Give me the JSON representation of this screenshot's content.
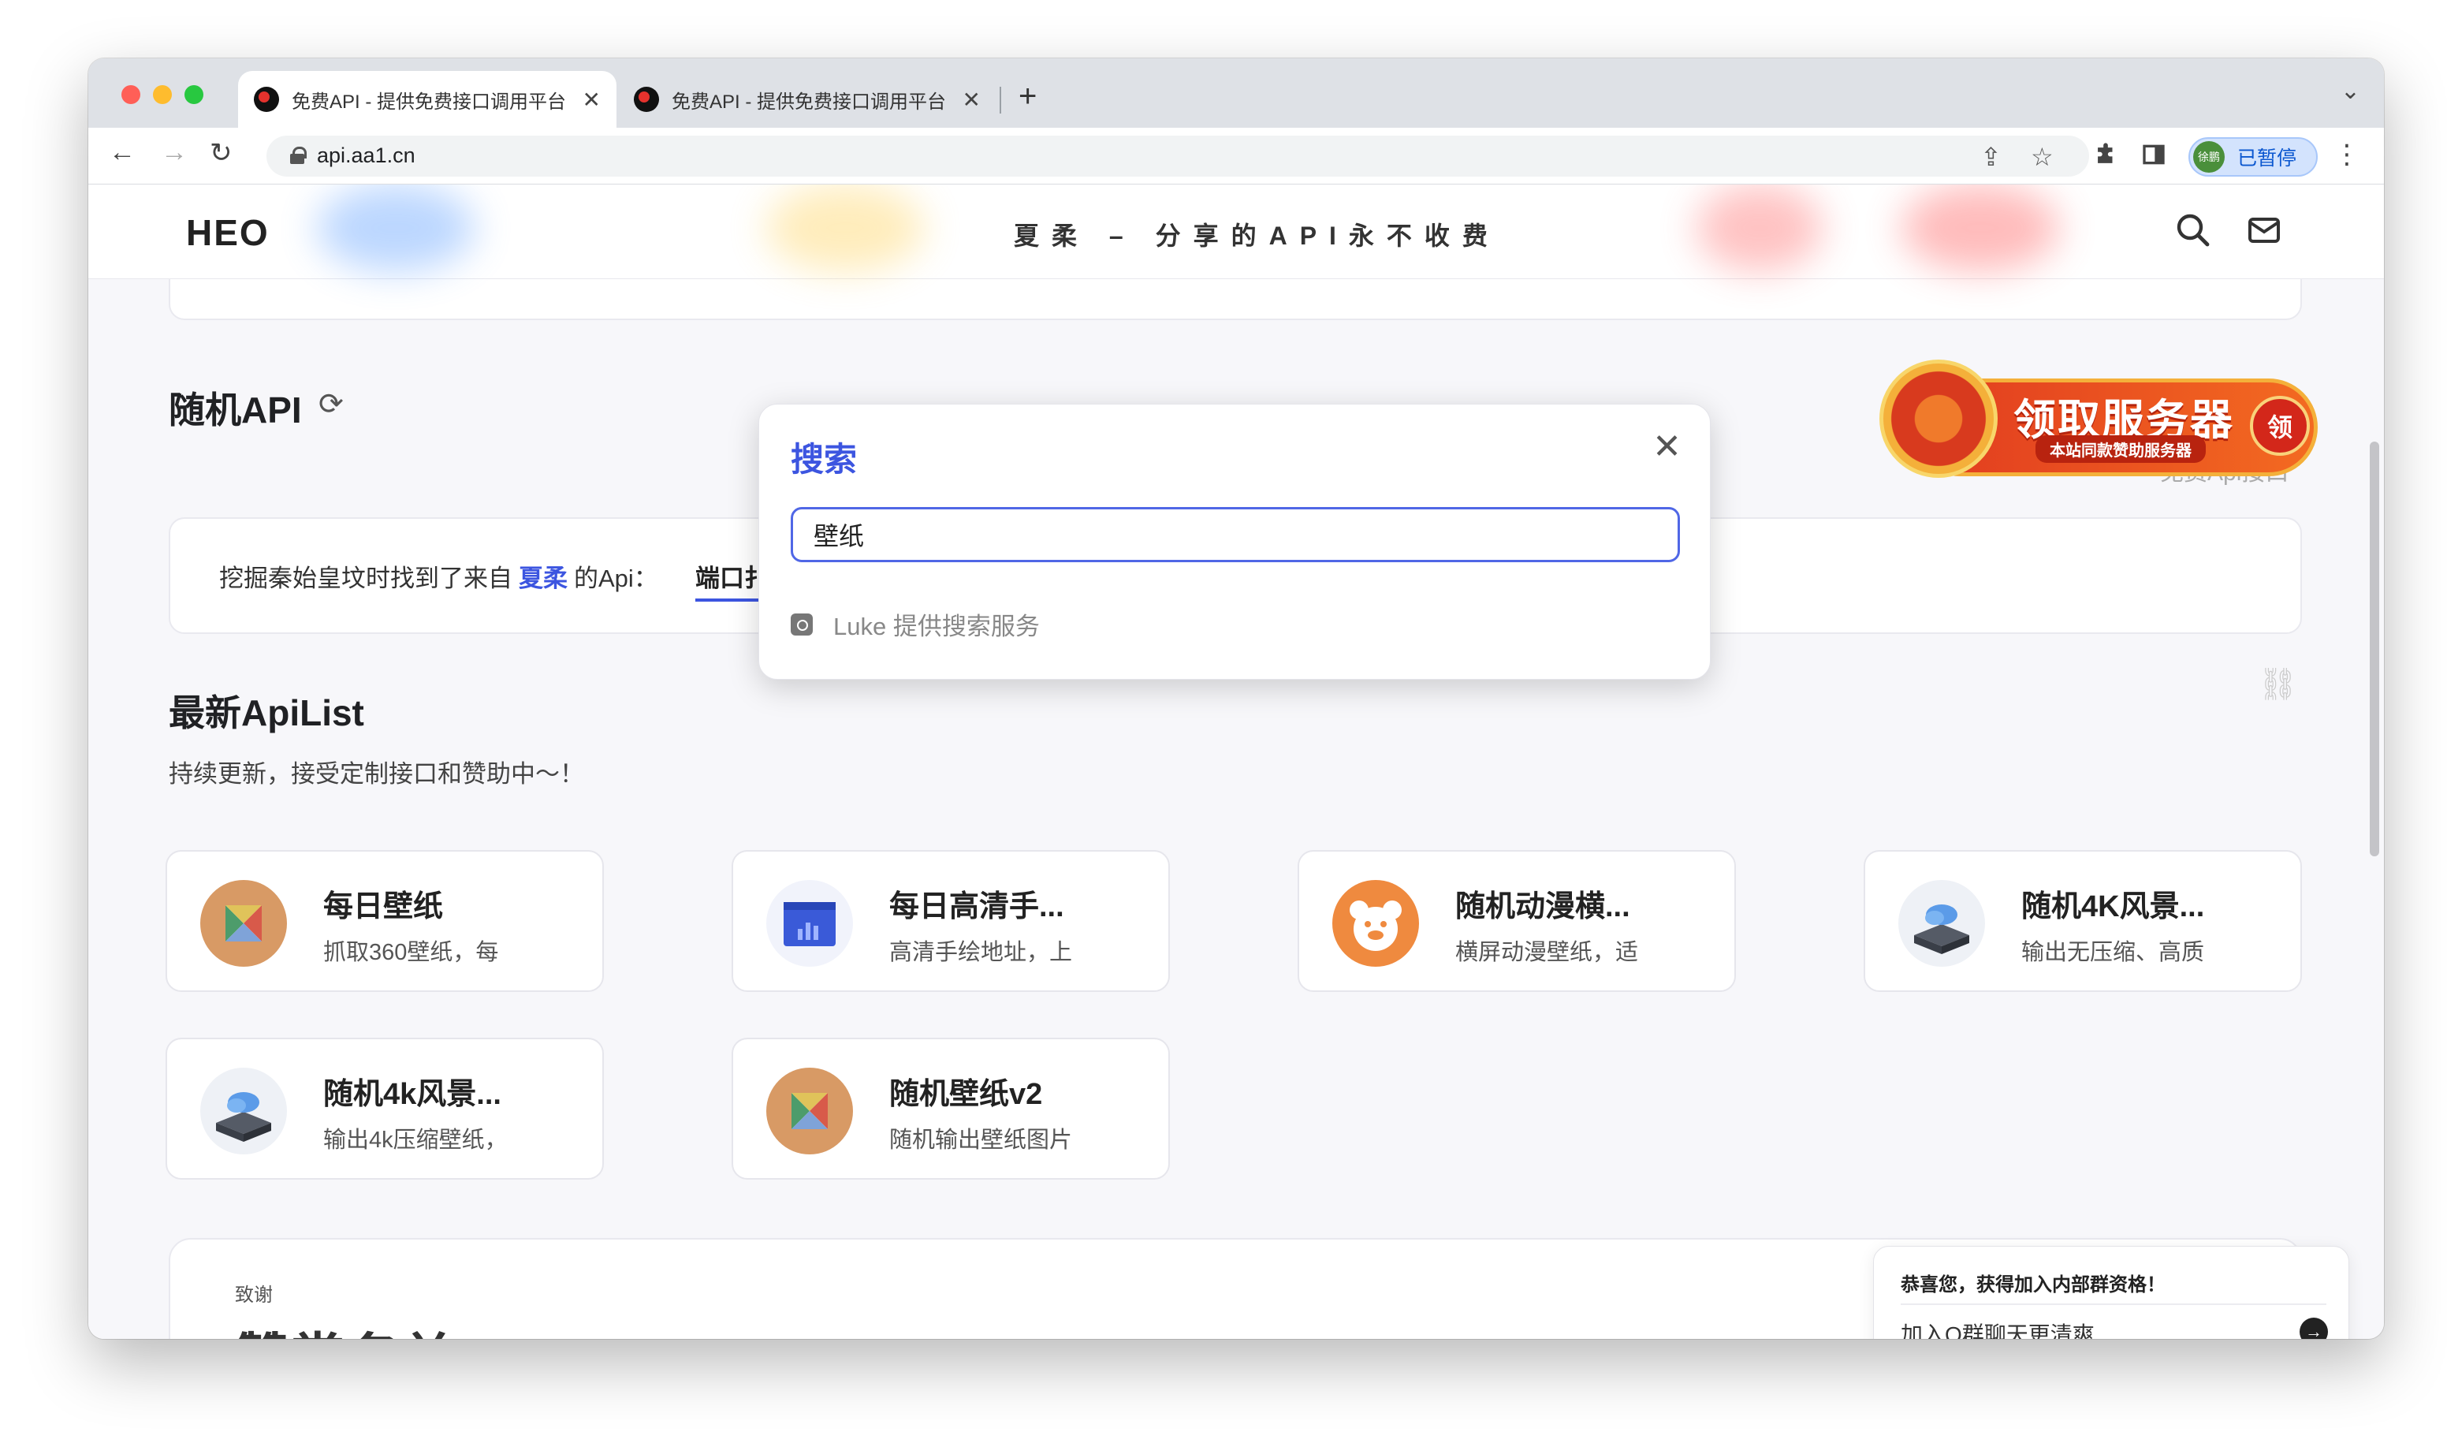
{
  "browser": {
    "tabs": [
      {
        "title": "免费API - 提供免费接口调用平台",
        "active": true
      },
      {
        "title": "免费API - 提供免费接口调用平台",
        "active": false
      }
    ],
    "new_tab": "+",
    "url": "api.aa1.cn",
    "profile_avatar": "徐鹏",
    "profile_status": "已暂停"
  },
  "site": {
    "logo": "HEO",
    "slogan": "夏柔 – 分享的API永不收费",
    "random_api": {
      "title": "随机API",
      "prefix": "挖掘秦始皇坟时找到了来自",
      "author": "夏柔",
      "suffix": "的Api：",
      "link": "端口扌"
    },
    "latest": {
      "title": "最新ApiList",
      "subtitle": "持续更新，接受定制接口和赞助中～！"
    },
    "api_cards": [
      {
        "title": "每日壁纸",
        "desc": "抓取360壁纸，每",
        "icon": "tangram-icon"
      },
      {
        "title": "每日高清手...",
        "desc": "高清手绘地址，上",
        "icon": "browser-chart-icon"
      },
      {
        "title": "随机动漫横...",
        "desc": "横屏动漫壁纸，适",
        "icon": "bear-icon"
      },
      {
        "title": "随机4K风景...",
        "desc": "输出无压缩、高质",
        "icon": "cloud-server-icon"
      },
      {
        "title": "随机4k风景...",
        "desc": "输出4k压缩壁纸，",
        "icon": "cloud-server-icon"
      },
      {
        "title": "随机壁纸v2",
        "desc": "随机输出壁纸图片",
        "icon": "tangram-icon"
      }
    ],
    "thanks": {
      "small": "致谢",
      "big": "赞赏名单"
    }
  },
  "search_modal": {
    "title": "搜索",
    "close": "✕",
    "query": "壁纸",
    "provider": "Luke 提供搜索服务"
  },
  "promo": {
    "title": "领取服务器",
    "subtitle": "本站同款赞助服务器",
    "coin": "领",
    "behind_text": "免费Api接口"
  },
  "toast": {
    "title": "恭喜您，获得加入内部群资格！",
    "text": "加入Q群聊天更清爽",
    "arrow": "→"
  },
  "colors": {
    "accent": "#3c55e0",
    "promo_red": "#e13b1f",
    "promo_gold": "#f4b03a"
  }
}
